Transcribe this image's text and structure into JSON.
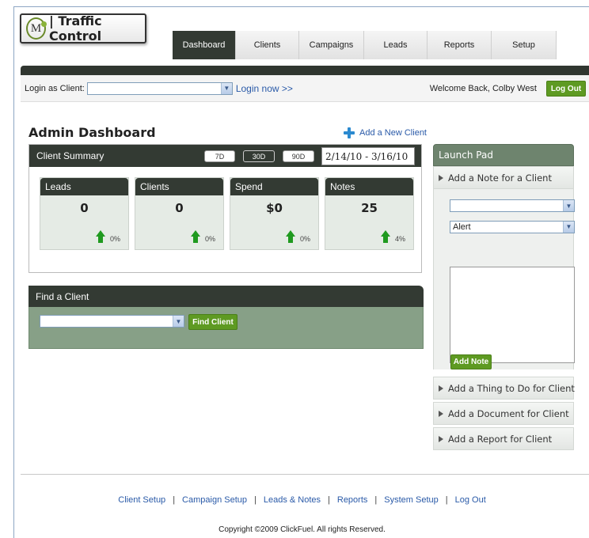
{
  "app": {
    "logo_letter": "M",
    "logo_text": "| Traffic Control"
  },
  "nav": {
    "tabs": [
      {
        "label": "Dashboard",
        "active": true
      },
      {
        "label": "Clients",
        "active": false
      },
      {
        "label": "Campaigns",
        "active": false
      },
      {
        "label": "Leads",
        "active": false
      },
      {
        "label": "Reports",
        "active": false
      },
      {
        "label": "Setup",
        "active": false
      }
    ]
  },
  "login_bar": {
    "label": "Login as Client:",
    "select_value": "",
    "login_link": "Login now >>",
    "welcome": "Welcome Back, Colby West",
    "logout_button": "Log Out"
  },
  "dashboard": {
    "title": "Admin Dashboard",
    "add_client": "Add a New Client"
  },
  "summary": {
    "title": "Client Summary",
    "ranges": [
      "7D",
      "30D",
      "90D"
    ],
    "selected_range": "30D",
    "date_range": "2/14/10 - 3/16/10",
    "stats": [
      {
        "label": "Leads",
        "value": "0",
        "change": "0%"
      },
      {
        "label": "Clients",
        "value": "0",
        "change": "0%"
      },
      {
        "label": "Spend",
        "value": "$0",
        "change": "0%"
      },
      {
        "label": "Notes",
        "value": "25",
        "change": "4%"
      }
    ]
  },
  "find": {
    "title": "Find a Client",
    "select_value": "",
    "button": "Find Client"
  },
  "launch_pad": {
    "title": "Launch Pad",
    "note_item": "Add a Note for a Client",
    "client_select_value": "",
    "type_select_value": "Alert",
    "note_text": "",
    "add_note_button": "Add Note",
    "items": [
      "Add a Thing to Do for Client",
      "Add a Document for Client",
      "Add a Report for Client"
    ]
  },
  "footer": {
    "links": [
      "Client Setup",
      "Campaign Setup",
      "Leads & Notes",
      "Reports",
      "System Setup",
      "Log Out"
    ],
    "separator": "|",
    "copyright": "Copyright ©2009 ClickFuel. All rights Reserved."
  },
  "colors": {
    "dark_header": "#333a33",
    "accent_green": "#5e9a22",
    "link_blue": "#2a5aa8",
    "find_panel": "#87a087",
    "launch_head": "#6e846e"
  },
  "icons": {
    "logo": "m-circle-logo",
    "add_client": "plus-icon",
    "trend": "up-arrow-icon",
    "dropdown": "chevron-down-icon",
    "launch_item": "triangle-right-icon"
  }
}
